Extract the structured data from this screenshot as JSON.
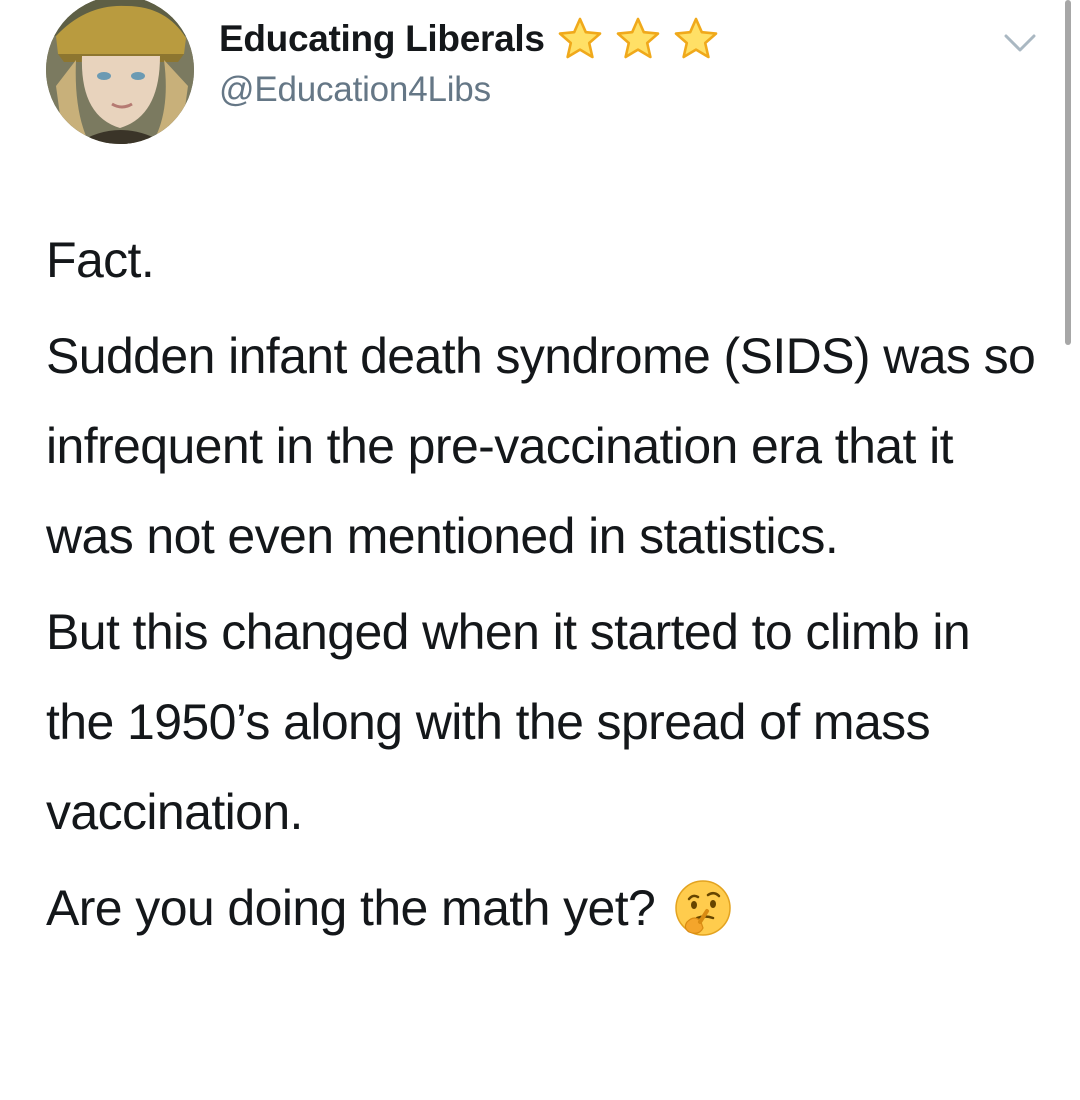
{
  "tweet": {
    "author": {
      "name": "Educating Liberals",
      "handle": "@Education4Libs",
      "name_badges": [
        "star-icon",
        "star-icon",
        "star-icon"
      ],
      "avatar": "profile-photo"
    },
    "menu_icon": "chevron-down-icon",
    "paragraphs": [
      "Fact.",
      "Sudden infant death syndrome (SIDS) was so infrequent in the pre-vaccination era that it was not even mentioned in statistics.",
      "But this changed when it started to climb in the 1950’s along with the spread of mass vaccination.",
      "Are you doing the math yet?"
    ],
    "trailing_emoji": "thinking-face-icon"
  },
  "colors": {
    "text": "#14171a",
    "handle": "#657786",
    "star_fill": "#ffe066",
    "star_stroke": "#f0a91b",
    "chevron": "#aab8c2",
    "scrollbar": "#a7a7a7"
  }
}
